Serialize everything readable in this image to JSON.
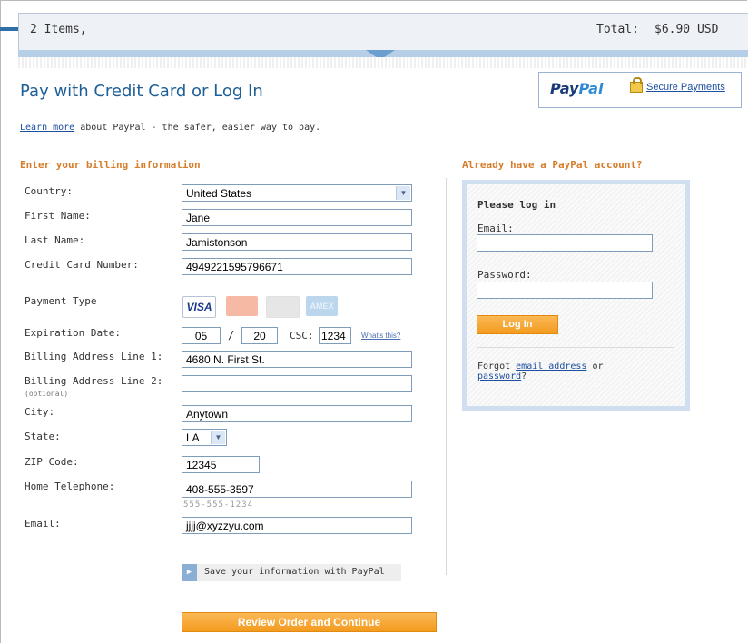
{
  "summary": {
    "items": "2 Items,",
    "total_label": "Total:",
    "total_value": "$6.90 USD"
  },
  "header": {
    "title": "Pay with Credit Card or Log In",
    "logo_text_1": "Pay",
    "logo_text_2": "Pal",
    "secure_link": "Secure Payments"
  },
  "learn": {
    "link": "Learn more",
    "text": " about PayPal - the safer, easier way to pay."
  },
  "billing": {
    "heading": "Enter your billing information",
    "labels": {
      "country": "Country:",
      "first_name": "First Name:",
      "last_name": "Last Name:",
      "cc_number": "Credit Card Number:",
      "payment_type": "Payment Type",
      "expiration": "Expiration Date:",
      "addr1": "Billing Address Line 1:",
      "addr2": "Billing Address Line 2:",
      "addr2_sub": "(optional)",
      "city": "City:",
      "state": "State:",
      "zip": "ZIP Code:",
      "phone": "Home Telephone:",
      "email": "Email:"
    },
    "values": {
      "country": "United States",
      "first_name": "Jane",
      "last_name": "Jamistonson",
      "cc_number": "4949221595796671",
      "exp_month": "05",
      "exp_year": "20",
      "csc": "1234",
      "addr1": "4680 N. First St.",
      "addr2": "",
      "city": "Anytown",
      "state": "LA",
      "zip": "12345",
      "phone": "408-555-3597",
      "email": "jjjj@xyzzyu.com"
    },
    "exp_separator": "/",
    "csc_label": "CSC:",
    "whats_this": "What's this?",
    "phone_hint": "555-555-1234",
    "cards": [
      "VISA",
      "MasterCard",
      "DISCOVER",
      "AMEX"
    ],
    "save_label": "Save your information with PayPal",
    "review_label": "Review Order and Continue"
  },
  "login": {
    "heading": "Already have a PayPal account?",
    "title": "Please log in",
    "email_label": "Email:",
    "password_label": "Password:",
    "button": "Log In",
    "forgot_prefix": "Forgot ",
    "forgot_email": "email address",
    "forgot_or": " or",
    "forgot_password": "password",
    "forgot_suffix": "?"
  },
  "colors": {
    "accent_orange": "#f39b1f",
    "heading_orange": "#d67d2a",
    "title_blue": "#1f5f96",
    "link_blue": "#1d4fa0"
  }
}
